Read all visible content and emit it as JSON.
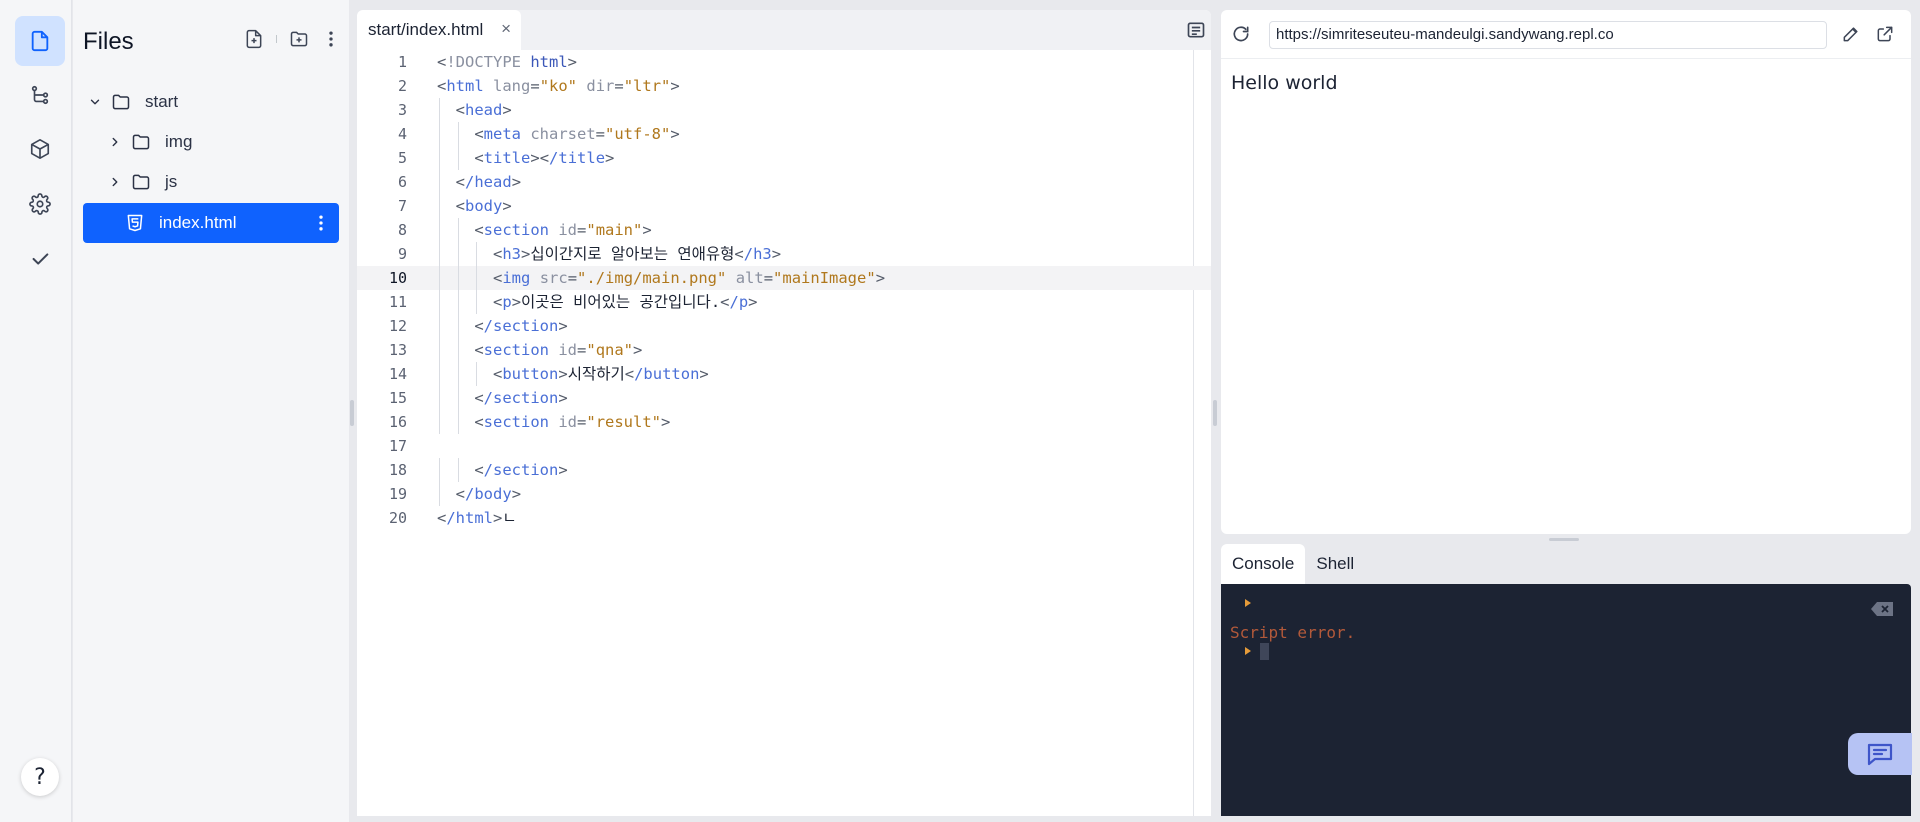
{
  "files_panel": {
    "title": "Files",
    "tree": [
      {
        "label": "start",
        "type": "folder",
        "expanded": true,
        "level": 0
      },
      {
        "label": "img",
        "type": "folder",
        "expanded": false,
        "level": 1
      },
      {
        "label": "js",
        "type": "folder",
        "expanded": false,
        "level": 1
      },
      {
        "label": "index.html",
        "type": "html-file",
        "selected": true,
        "level": 1
      }
    ]
  },
  "editor": {
    "tab_label": "start/index.html",
    "tab_close": "×",
    "active_line": 10,
    "lines": [
      "<!DOCTYPE html>",
      "<html lang=\"ko\" dir=\"ltr\">",
      "  <head>",
      "    <meta charset=\"utf-8\">",
      "    <title></title>",
      "  </head>",
      "  <body>",
      "    <section id=\"main\">",
      "      <h3>십이간지로 알아보는 연애유형</h3>",
      "      <img src=\"./img/main.png\" alt=\"mainImage\">",
      "      <p>이곳은 비어있는 공간입니다.</p>",
      "    </section>",
      "    <section id=\"qna\">",
      "      <button>시작하기</button>",
      "    </section>",
      "    <section id=\"result\">",
      "",
      "    </section>",
      "  </body>",
      "</html>ㄴ"
    ]
  },
  "preview": {
    "url": "https://simriteseuteu-mandeulgi.sandywang.repl.co",
    "content": "Hello world"
  },
  "console": {
    "tabs": [
      "Console",
      "Shell"
    ],
    "active_tab": "Console",
    "error_text": "Script error."
  },
  "colors": {
    "accent": "#0f62fe",
    "console_bg": "#1c2333",
    "tag": "#4a6fd6",
    "attr_value": "#b0781d"
  }
}
